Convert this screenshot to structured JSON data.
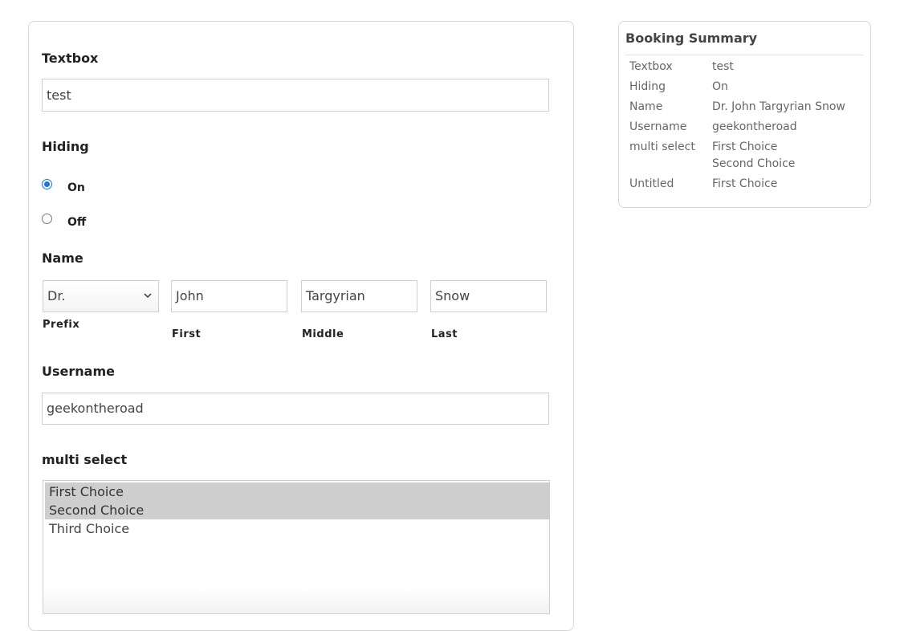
{
  "form": {
    "textbox": {
      "label": "Textbox",
      "value": "test"
    },
    "hiding": {
      "label": "Hiding",
      "options": [
        {
          "label": "On",
          "checked": true
        },
        {
          "label": "Off",
          "checked": false
        }
      ]
    },
    "name": {
      "label": "Name",
      "prefix": {
        "value": "Dr.",
        "label": "Prefix"
      },
      "first": {
        "value": "John",
        "label": "First"
      },
      "middle": {
        "value": "Targyrian",
        "label": "Middle"
      },
      "last": {
        "value": "Snow",
        "label": "Last"
      }
    },
    "username": {
      "label": "Username",
      "value": "geekontheroad"
    },
    "multi_select": {
      "label": "multi select",
      "options": [
        {
          "label": "First Choice",
          "selected": true
        },
        {
          "label": "Second Choice",
          "selected": true
        },
        {
          "label": "Third Choice",
          "selected": false
        }
      ]
    }
  },
  "summary": {
    "title": "Booking Summary",
    "rows": [
      {
        "key": "Textbox",
        "value": "test"
      },
      {
        "key": "Hiding",
        "value": "On"
      },
      {
        "key": "Name",
        "value": "Dr. John Targyrian Snow"
      },
      {
        "key": "Username",
        "value": "geekontheroad"
      },
      {
        "key": "multi select",
        "value": "First Choice",
        "value2": "Second Choice"
      },
      {
        "key": "Untitled",
        "value": "First Choice"
      }
    ]
  },
  "colors": {
    "radio_accent": "#1a73e8",
    "selected_option_bg": "#cecece"
  }
}
